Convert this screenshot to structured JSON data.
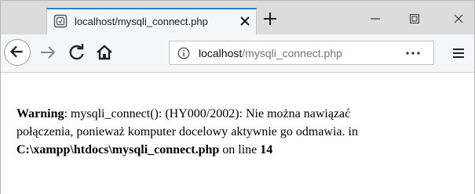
{
  "tab": {
    "title": "localhost/mysqli_connect.php"
  },
  "urlbar": {
    "host": "localhost",
    "path": "/mysqli_connect.php"
  },
  "warning": {
    "label": "Warning",
    "line1_rest": ": mysqli_connect(): (HY000/2002): Nie można nawiązać",
    "line2": "połączenia, ponieważ komputer docelowy aktywnie go odmawia. in",
    "file": "C:\\xampp\\htdocs\\mysqli_connect.php",
    "on_line_text": " on line ",
    "line_number": "14"
  },
  "icons": [
    "page-favicon-icon",
    "close-icon",
    "plus-icon",
    "minimize-icon",
    "maximize-icon",
    "window-close-icon",
    "back-arrow-icon",
    "forward-arrow-icon",
    "reload-icon",
    "home-icon",
    "info-icon",
    "more-icon",
    "hamburger-menu-icon"
  ],
  "colors": {
    "accent": "#0a84ff",
    "tabstrip": "#dcdcdc",
    "toolbar": "#f5f6f7"
  }
}
